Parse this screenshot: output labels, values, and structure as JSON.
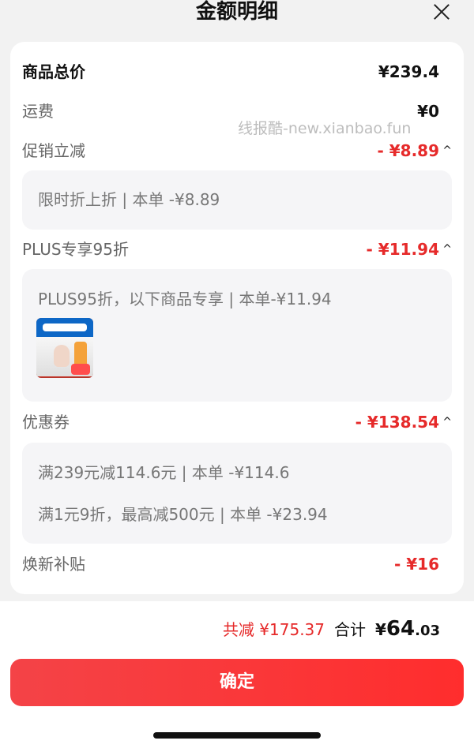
{
  "header": {
    "title": "金额明细"
  },
  "rows": {
    "goods_total": {
      "label": "商品总价",
      "value": "¥239.4"
    },
    "shipping": {
      "label": "运费",
      "value": "¥0"
    },
    "promotion": {
      "label": "促销立减",
      "value": "- ¥8.89",
      "caret": "^"
    },
    "plus": {
      "label": "PLUS专享95折",
      "value": "- ¥11.94",
      "caret": "^"
    },
    "coupon": {
      "label": "优惠券",
      "value": "- ¥138.54",
      "caret": "^"
    },
    "subsidy": {
      "label": "焕新补贴",
      "value": "- ¥16"
    }
  },
  "details": {
    "promotion_line": "限时折上折 | 本单 -¥8.89",
    "plus_line": "PLUS95折，以下商品专享 | 本单-¥11.94",
    "coupon_lines": [
      "满239元减114.6元 | 本单 -¥114.6",
      "满1元9折，最高减500元 | 本单 -¥23.94"
    ]
  },
  "watermark": "线报酷-new.xianbao.fun",
  "summary": {
    "reduce": "共减 ¥175.37",
    "total_label": "合计",
    "total_prefix": "¥",
    "total_big": "64",
    "total_small": ".03"
  },
  "confirm_label": "确定",
  "colors": {
    "accent": "#e62a2a",
    "button_start": "#f44347",
    "button_end": "#ff2d2d"
  }
}
